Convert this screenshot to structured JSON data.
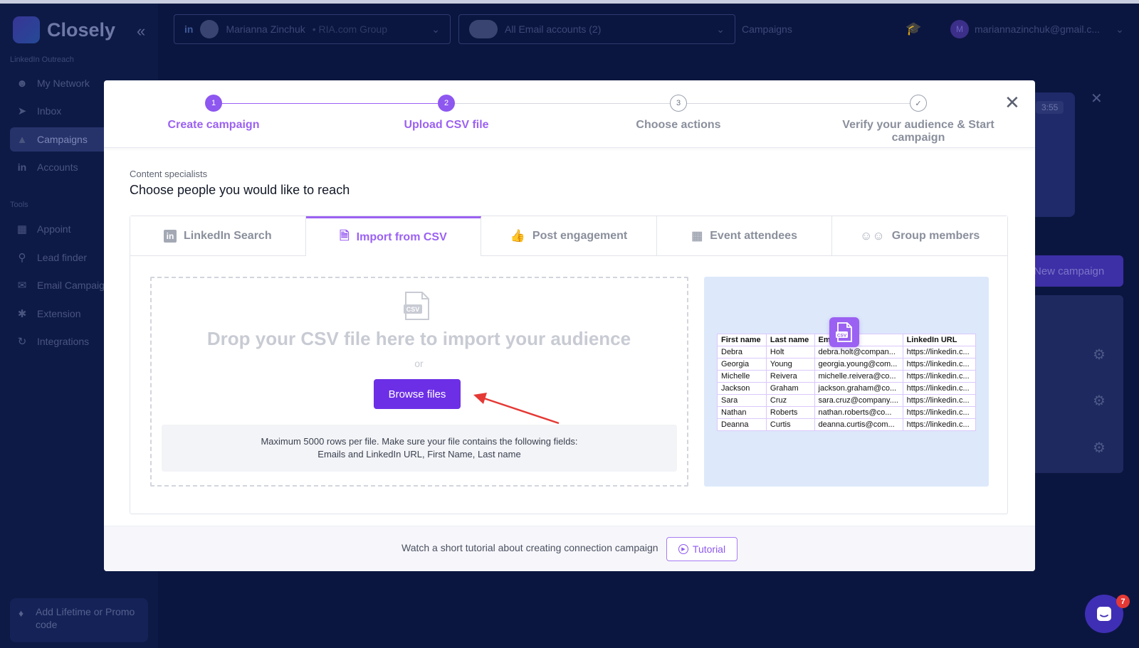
{
  "app": {
    "name": "Closely",
    "sidebar": {
      "section_linkedin": "LinkedIn Outreach",
      "section_tools": "Tools",
      "items": [
        {
          "label": "My Network",
          "icon": "people-icon"
        },
        {
          "label": "Inbox",
          "icon": "send-icon"
        },
        {
          "label": "Campaigns",
          "icon": "megaphone-icon"
        },
        {
          "label": "Accounts",
          "icon": "linkedin-icon"
        },
        {
          "label": "Appoint",
          "icon": "calendar-icon"
        },
        {
          "label": "Lead finder",
          "icon": "search-icon"
        },
        {
          "label": "Email Campaigns",
          "icon": "mail-icon"
        },
        {
          "label": "Extension",
          "icon": "puzzle-icon"
        },
        {
          "label": "Integrations",
          "icon": "integrations-icon"
        }
      ],
      "promo": "Add Lifetime or Promo code"
    },
    "topbar": {
      "account_name": "Marianna Zinchuk",
      "account_group": "• RIA.com Group",
      "email_accounts": "All Email accounts (2)",
      "campaigns_link": "Campaigns",
      "user_email": "mariannazinchuk@gmail.c...",
      "user_initial": "M"
    },
    "background": {
      "timer": "3:55",
      "new_campaign": "New campaign"
    }
  },
  "modal": {
    "steps": [
      {
        "number": "1",
        "label": "Create campaign",
        "state": "done"
      },
      {
        "number": "2",
        "label": "Upload CSV file",
        "state": "done"
      },
      {
        "number": "3",
        "label": "Choose actions",
        "state": "todo"
      },
      {
        "number": "✓",
        "label": "Verify your audience & Start campaign",
        "state": "todo"
      }
    ],
    "subtitle": "Content specialists",
    "title": "Choose people you would like to reach",
    "tabs": [
      {
        "label": "LinkedIn Search",
        "icon": "linkedin-icon"
      },
      {
        "label": "Import from CSV",
        "icon": "csv-file-icon"
      },
      {
        "label": "Post engagement",
        "icon": "thumbs-up-icon"
      },
      {
        "label": "Event attendees",
        "icon": "calendar-icon"
      },
      {
        "label": "Group members",
        "icon": "group-icon"
      }
    ],
    "active_tab": "Import from CSV",
    "dropzone": {
      "title": "Drop your CSV file here to import your audience",
      "or": "or",
      "browse_button": "Browse files",
      "hint_line1": "Maximum 5000 rows per file. Make sure your file contains the following fields:",
      "hint_line2": "Emails and LinkedIn URL, First Name, Last name"
    },
    "preview_table": {
      "headers": [
        "First name",
        "Last name",
        "Email",
        "LinkedIn URL"
      ],
      "rows": [
        [
          "Debra",
          "Holt",
          "debra.holt@compan...",
          "https://linkedin.c..."
        ],
        [
          "Georgia",
          "Young",
          "georgia.young@com...",
          "https://linkedin.c..."
        ],
        [
          "Michelle",
          "Reivera",
          "michelle.reivera@co...",
          "https://linkedin.c..."
        ],
        [
          "Jackson",
          "Graham",
          "jackson.graham@co...",
          "https://linkedin.c..."
        ],
        [
          "Sara",
          "Cruz",
          "sara.cruz@company....",
          "https://linkedin.c..."
        ],
        [
          "Nathan",
          "Roberts",
          "nathan.roberts@co...",
          "https://linkedin.c..."
        ],
        [
          "Deanna",
          "Curtis",
          "deanna.curtis@com...",
          "https://linkedin.c..."
        ]
      ]
    },
    "footer": {
      "text": "Watch a short tutorial about creating connection campaign",
      "tutorial_button": "Tutorial"
    }
  },
  "chat": {
    "badge_count": "7"
  },
  "colors": {
    "accent": "#9b61f2",
    "primary_button": "#6d2fe6",
    "backdrop": "#0b1640",
    "annotation_arrow": "#e53935"
  }
}
